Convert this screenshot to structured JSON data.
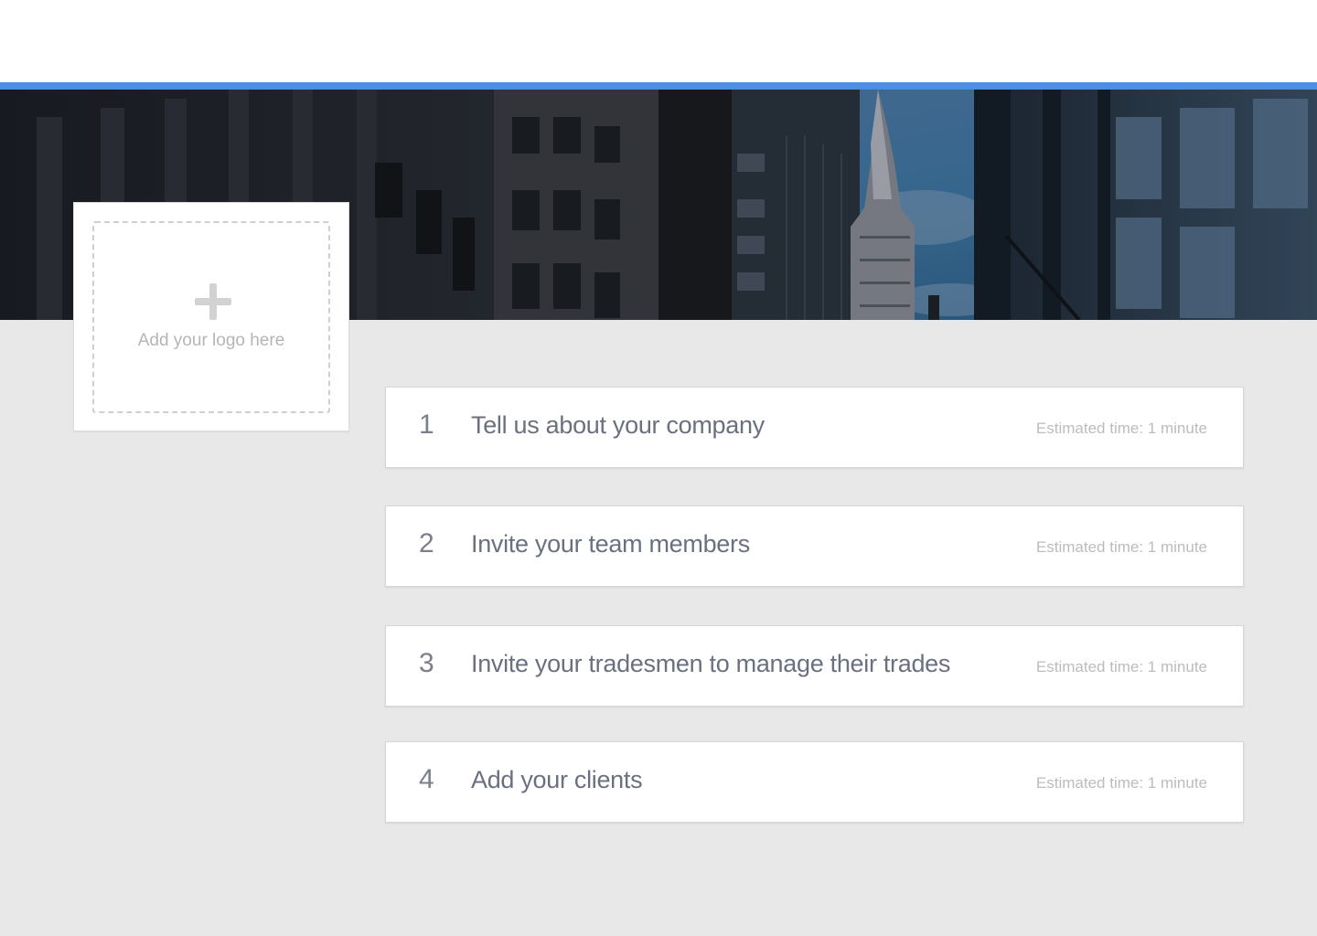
{
  "theme": {
    "accent_color": "#4a90e2",
    "background_color": "#e8e8e8",
    "card_color": "#ffffff"
  },
  "header": {
    "banner_image": "city-skyline-photo"
  },
  "logo_upload": {
    "icon": "plus-icon",
    "label": "Add your logo here"
  },
  "steps": [
    {
      "number": "1",
      "title": "Tell us about your company",
      "estimate": "Estimated time: 1 minute"
    },
    {
      "number": "2",
      "title": "Invite your team members",
      "estimate": "Estimated time: 1 minute"
    },
    {
      "number": "3",
      "title": "Invite your tradesmen to manage their trades",
      "estimate": "Estimated time: 1 minute"
    },
    {
      "number": "4",
      "title": "Add your clients",
      "estimate": "Estimated time: 1 minute"
    }
  ]
}
